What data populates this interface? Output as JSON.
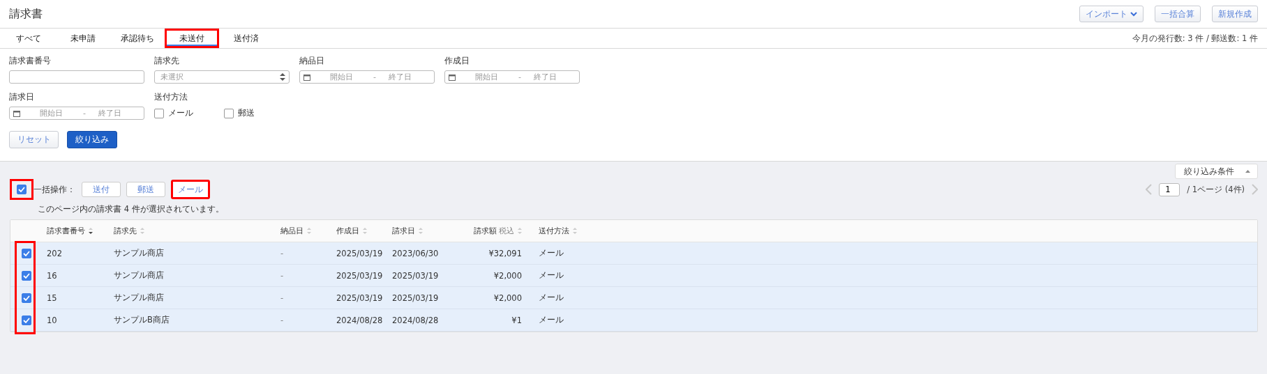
{
  "page_title": "請求書",
  "header_buttons": [
    {
      "label": "インポート",
      "kind": "dropdown"
    },
    {
      "label": "一括合算",
      "kind": "plain"
    },
    {
      "label": "新規作成",
      "kind": "plain"
    }
  ],
  "tabs": [
    {
      "label": "すべて",
      "selected": false,
      "highlighted": false
    },
    {
      "label": "未申請",
      "selected": false,
      "highlighted": false
    },
    {
      "label": "承認待ち",
      "selected": false,
      "highlighted": false
    },
    {
      "label": "未送付",
      "selected": true,
      "highlighted": true
    },
    {
      "label": "送付済",
      "selected": false,
      "highlighted": false
    }
  ],
  "monthly_count": "今月の発行数: 3 件 / 郵送数: 1 件",
  "filters": [
    {
      "kind": "text",
      "label": "請求書番号"
    },
    {
      "kind": "select",
      "label": "請求先",
      "placeholder": "未選択"
    },
    {
      "kind": "daterange",
      "label": "納品日",
      "start_placeholder": "開始日",
      "separator": "-",
      "end_placeholder": "終了日"
    },
    {
      "kind": "daterange",
      "label": "作成日",
      "start_placeholder": "開始日",
      "separator": "-",
      "end_placeholder": "終了日"
    },
    {
      "kind": "daterange",
      "label": "請求日",
      "start_placeholder": "開始日",
      "separator": "-",
      "end_placeholder": "終了日"
    },
    {
      "kind": "checkboxes",
      "label": "送付方法",
      "options": [
        {
          "label": "メール",
          "checked": false
        },
        {
          "label": "郵送",
          "checked": false
        }
      ]
    }
  ],
  "filter_buttons": [
    {
      "label": "リセット",
      "kind": "secondary"
    },
    {
      "label": "絞り込み",
      "kind": "primary"
    }
  ],
  "filter_toggle": {
    "label": "絞り込み条件",
    "expanded": true
  },
  "bulk": {
    "select_all_checked": true,
    "select_all_highlighted": true,
    "label": "一括操作：",
    "buttons": [
      {
        "label": "送付",
        "highlighted": false
      },
      {
        "label": "郵送",
        "highlighted": false
      },
      {
        "label": "メール",
        "highlighted": true
      }
    ],
    "message": "このページ内の請求書 4 件が選択されています。"
  },
  "pagination": {
    "page": "1",
    "total": "/ 1ページ (4件)",
    "prev_disabled": true,
    "next_disabled": true
  },
  "table": {
    "checkbox_column_highlighted": true,
    "columns": [
      {
        "label": "請求書番号",
        "kind": "text",
        "sorted": true
      },
      {
        "label": "請求先",
        "kind": "text",
        "sorted": false
      },
      {
        "label": "納品日",
        "kind": "muted",
        "sorted": false
      },
      {
        "label": "作成日",
        "kind": "text",
        "sorted": false
      },
      {
        "label": "請求日",
        "kind": "text",
        "sorted": false
      },
      {
        "label": "請求額",
        "note": "税込",
        "kind": "amount",
        "sorted": false
      },
      {
        "label": "送付方法",
        "kind": "text",
        "sorted": false
      }
    ],
    "rows": [
      {
        "selected": true,
        "cells": [
          "202",
          "サンプル商店",
          "-",
          "2025/03/19",
          "2023/06/30",
          "¥32,091",
          "メール"
        ]
      },
      {
        "selected": true,
        "cells": [
          "16",
          "サンプル商店",
          "-",
          "2025/03/19",
          "2025/03/19",
          "¥2,000",
          "メール"
        ]
      },
      {
        "selected": true,
        "cells": [
          "15",
          "サンプル商店",
          "-",
          "2025/03/19",
          "2025/03/19",
          "¥2,000",
          "メール"
        ]
      },
      {
        "selected": true,
        "cells": [
          "10",
          "サンプルB商店",
          "-",
          "2024/08/28",
          "2024/08/28",
          "¥1",
          "メール"
        ]
      }
    ]
  }
}
